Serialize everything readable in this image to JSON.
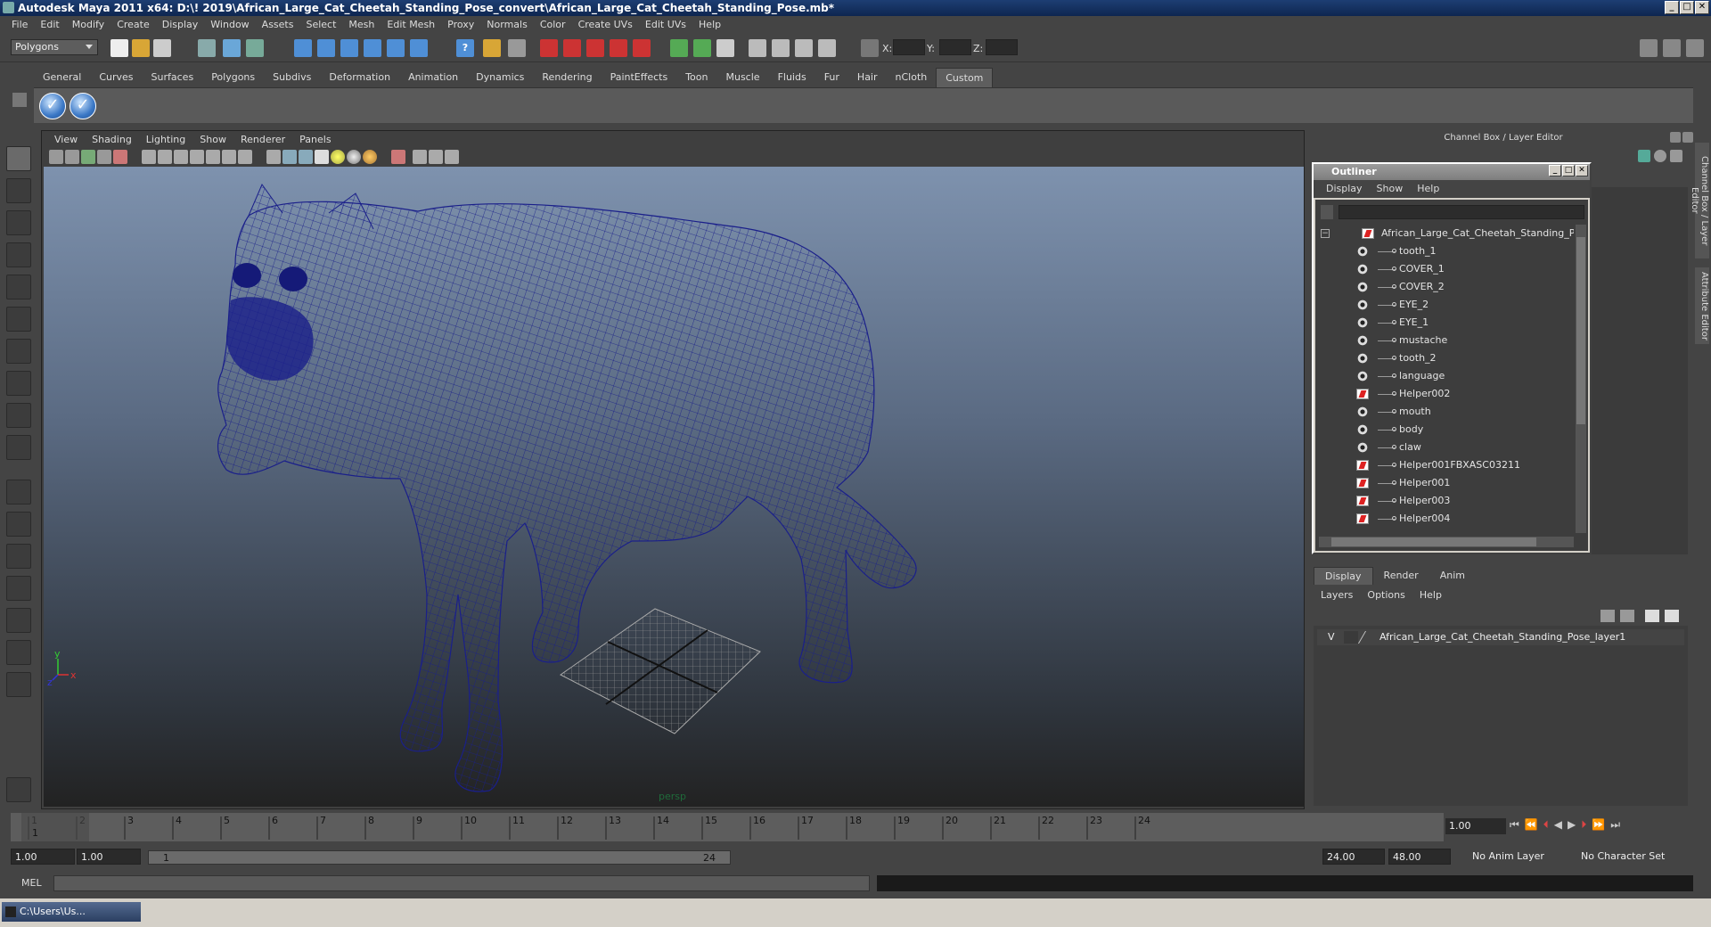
{
  "window": {
    "title": "Autodesk Maya 2011 x64: D:\\! 2019\\African_Large_Cat_Cheetah_Standing_Pose_convert\\African_Large_Cat_Cheetah_Standing_Pose.mb*",
    "min_label": "_",
    "max_label": "□",
    "close_label": "✕"
  },
  "menubar": [
    "File",
    "Edit",
    "Modify",
    "Create",
    "Display",
    "Window",
    "Assets",
    "Select",
    "Mesh",
    "Edit Mesh",
    "Proxy",
    "Normals",
    "Color",
    "Create UVs",
    "Edit UVs",
    "Help"
  ],
  "statusline": {
    "mode_combo": "Polygons",
    "x_label": "X:",
    "y_label": "Y:",
    "z_label": "Z:"
  },
  "shelf_tabs": [
    "General",
    "Curves",
    "Surfaces",
    "Polygons",
    "Subdivs",
    "Deformation",
    "Animation",
    "Dynamics",
    "Rendering",
    "PaintEffects",
    "Toon",
    "Muscle",
    "Fluids",
    "Fur",
    "Hair",
    "nCloth",
    "Custom"
  ],
  "shelf_active_tab": "Custom",
  "viewport": {
    "menu": [
      "View",
      "Shading",
      "Lighting",
      "Show",
      "Renderer",
      "Panels"
    ],
    "camera_label": "persp",
    "axis_x": "x",
    "axis_y": "y",
    "axis_z": "z",
    "wire_color": "#1a1f8a"
  },
  "channel_box": {
    "header": "Channel Box / Layer Editor"
  },
  "outliner": {
    "title": "Outliner",
    "menu": [
      "Display",
      "Show",
      "Help"
    ],
    "root": "African_Large_Cat_Cheetah_Standing_Pose",
    "children": [
      {
        "name": "tooth_1",
        "icon": "eye-icon"
      },
      {
        "name": "COVER_1",
        "icon": "eye-icon"
      },
      {
        "name": "COVER_2",
        "icon": "eye-icon"
      },
      {
        "name": "EYE_2",
        "icon": "eye-icon"
      },
      {
        "name": "EYE_1",
        "icon": "eye-icon"
      },
      {
        "name": "mustache",
        "icon": "eye-icon"
      },
      {
        "name": "tooth_2",
        "icon": "eye-icon"
      },
      {
        "name": "language",
        "icon": "eye-icon"
      },
      {
        "name": "Helper002",
        "icon": "helper-icon"
      },
      {
        "name": "mouth",
        "icon": "eye-icon"
      },
      {
        "name": "body",
        "icon": "eye-icon"
      },
      {
        "name": "claw",
        "icon": "eye-icon"
      },
      {
        "name": "Helper001FBXASC03211",
        "icon": "helper-icon"
      },
      {
        "name": "Helper001",
        "icon": "helper-icon"
      },
      {
        "name": "Helper003",
        "icon": "helper-icon"
      },
      {
        "name": "Helper004",
        "icon": "helper-icon"
      }
    ]
  },
  "layer_editor": {
    "tabs": [
      "Display",
      "Render",
      "Anim"
    ],
    "active_tab": "Display",
    "menu": [
      "Layers",
      "Options",
      "Help"
    ],
    "layer_visible": "V",
    "layer_name": "African_Large_Cat_Cheetah_Standing_Pose_layer1"
  },
  "timeline": {
    "ticks": [
      "1",
      "2",
      "3",
      "4",
      "5",
      "6",
      "7",
      "8",
      "9",
      "10",
      "11",
      "12",
      "13",
      "14",
      "15",
      "16",
      "17",
      "18",
      "19",
      "20",
      "21",
      "22",
      "23",
      "24"
    ],
    "current_frame": "1.00",
    "current_marker": "1"
  },
  "range": {
    "start": "1.00",
    "playback_start": "1.00",
    "slider_start": "1",
    "slider_end": "24",
    "playback_end": "24.00",
    "end": "48.00",
    "anim_layer": "No Anim Layer",
    "char_set": "No Character Set"
  },
  "cmdline": {
    "label": "MEL"
  },
  "taskbar": {
    "item": "C:\\Users\\Us..."
  },
  "side_tabs": [
    "Channel Box / Layer Editor",
    "Attribute Editor"
  ]
}
